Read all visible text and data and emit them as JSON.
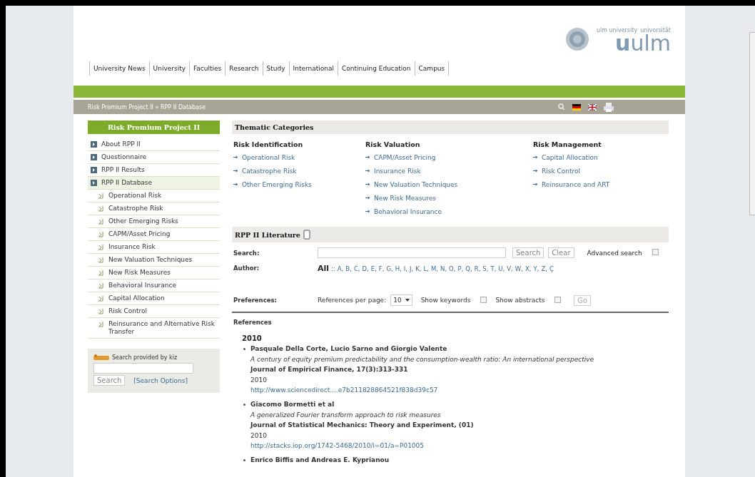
{
  "header": {
    "nav": [
      "University News",
      "University",
      "Faculties",
      "Research",
      "Study",
      "International",
      "Continuing Education",
      "Campus"
    ],
    "logo": {
      "small_1": "ulm university",
      "small_2": "universität",
      "wordmark": "**u**ulm"
    },
    "breadcrumb": "Risk Premium Project II » RPP II Database"
  },
  "sidebar": {
    "title": "Risk Premium Project II",
    "items": [
      {
        "kind": "section",
        "label": "About RPP II",
        "selected": false
      },
      {
        "kind": "section",
        "label": "Questionnaire",
        "selected": false
      },
      {
        "kind": "section",
        "label": "RPP II Results",
        "selected": false
      },
      {
        "kind": "section",
        "label": "RPP II Database",
        "selected": true
      },
      {
        "kind": "sub",
        "label": "Operational Risk",
        "selected": false
      },
      {
        "kind": "sub",
        "label": "Catastrophe Risk",
        "selected": false
      },
      {
        "kind": "sub",
        "label": "Other Emerging Risks",
        "selected": false
      },
      {
        "kind": "sub",
        "label": "CAPM/Asset Pricing",
        "selected": false
      },
      {
        "kind": "sub",
        "label": "Insurance Risk",
        "selected": false
      },
      {
        "kind": "sub",
        "label": "New Valuation Techniques",
        "selected": false
      },
      {
        "kind": "sub",
        "label": "New Risk Measures",
        "selected": false
      },
      {
        "kind": "sub",
        "label": "Behavioral Insurance",
        "selected": false
      },
      {
        "kind": "sub",
        "label": "Capital Allocation",
        "selected": false
      },
      {
        "kind": "sub",
        "label": "Risk Control",
        "selected": false
      },
      {
        "kind": "sub",
        "label": "Reinsurance and Alternative Risk Transfer",
        "selected": false
      }
    ],
    "search": {
      "caption": "Search provided by kiz",
      "button": "Search",
      "options": "[Search Options]"
    }
  },
  "thematic": {
    "title": "Thematic Categories",
    "columns": [
      {
        "heading": "Risk Identification",
        "links": [
          "Operational Risk",
          "Catastrophe Risk",
          "Other Emerging Risks"
        ]
      },
      {
        "heading": "Risk Valuation",
        "links": [
          "CAPM/Asset Pricing",
          "Insurance Risk",
          "New Valuation Techniques",
          "New Risk Measures",
          "Behavioral Insurance"
        ]
      },
      {
        "heading": "Risk Management",
        "links": [
          "Capital Allocation",
          "Risk Control",
          "Reinsurance and ART"
        ]
      }
    ]
  },
  "literature": {
    "title": "RPP II Literature",
    "search_label": "Search:",
    "search_button": "Search",
    "clear_button": "Clear",
    "advanced": {
      "label": "Advanced search",
      "checked": false
    },
    "author_label": "Author:",
    "separator": "::",
    "author_filter": [
      {
        "label": "All",
        "selected": true
      },
      {
        "label": "A,",
        "selected": false
      },
      {
        "label": "B,",
        "selected": false
      },
      {
        "label": "C,",
        "selected": false
      },
      {
        "label": "D,",
        "selected": false
      },
      {
        "label": "E,",
        "selected": false
      },
      {
        "label": "F,",
        "selected": false
      },
      {
        "label": "G,",
        "selected": false
      },
      {
        "label": "H,",
        "selected": false
      },
      {
        "label": "I,",
        "selected": false
      },
      {
        "label": "J,",
        "selected": false
      },
      {
        "label": "K,",
        "selected": false
      },
      {
        "label": "L,",
        "selected": false
      },
      {
        "label": "M,",
        "selected": false
      },
      {
        "label": "N,",
        "selected": false
      },
      {
        "label": "O,",
        "selected": false
      },
      {
        "label": "P,",
        "selected": false
      },
      {
        "label": "Q,",
        "selected": false
      },
      {
        "label": "R,",
        "selected": false
      },
      {
        "label": "S,",
        "selected": false
      },
      {
        "label": "T,",
        "selected": false
      },
      {
        "label": "U,",
        "selected": false
      },
      {
        "label": "V,",
        "selected": false
      },
      {
        "label": "W,",
        "selected": false
      },
      {
        "label": "X,",
        "selected": false
      },
      {
        "label": "Y,",
        "selected": false
      },
      {
        "label": "Z,",
        "selected": false
      },
      {
        "label": "Ç",
        "selected": false
      }
    ],
    "preferences_label": "Preferences:",
    "per_page_label": "References per page:",
    "per_page": "10",
    "keywords": {
      "label": "Show keywords",
      "checked": false
    },
    "abstracts": {
      "label": "Show abstracts",
      "checked": false
    },
    "go_button": "Go"
  },
  "references": {
    "title": "References",
    "year": "2010",
    "entries": [
      {
        "authors": "Pasquale Della Corte, Lucio Sarno and Giorgio Valente",
        "title": "A century of equity premium predictability and the consumption-wealth ratio: An international perspective",
        "journal": "Journal of Empirical Finance, 17(3):313-331",
        "year": "2010",
        "url": "http://www.sciencedirect....e7b211828864521f838d39c57"
      },
      {
        "authors": "Giacomo Bormetti et al",
        "title": "A generalized Fourier transform approach to risk measures",
        "journal": "Journal of Statistical Mechanics: Theory and Experiment, (01)",
        "year": "2010",
        "url": "http://stacks.iop.org/1742-5468/2010/i=01/a=P01005"
      },
      {
        "authors": "Enrico Biffis and Andreas E. Kyprianou"
      }
    ]
  }
}
